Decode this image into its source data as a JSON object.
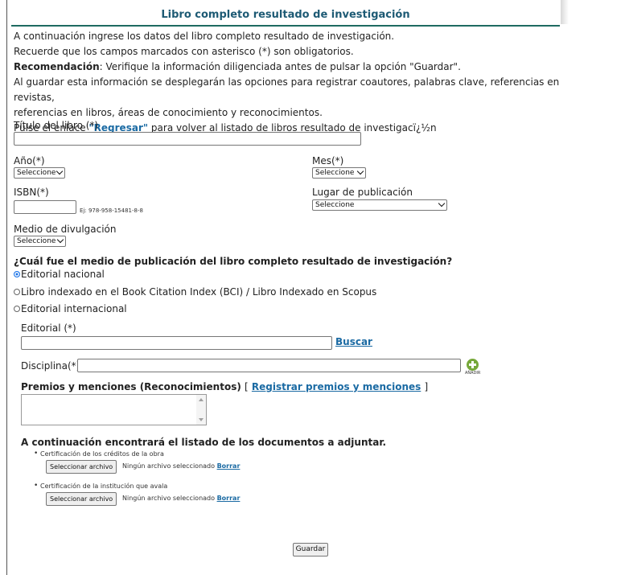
{
  "title": "Libro completo resultado de investigación",
  "intro": {
    "line1": "A continuación ingrese los datos del libro completo resultado de investigación.",
    "line2": "Recuerde que los campos marcados con asterisco (*) son obligatorios.",
    "rec_label": "Recomendación",
    "rec_text": ": Verifique la información diligenciada antes de pulsar la opción \"Guardar\".",
    "line4": "Al guardar esta información se desplegarán las opciones para registrar coautores, palabras clave, referencias en revistas,",
    "line5": "referencias en libros, áreas de conocimiento y reconocimientos.",
    "return_pre": "Pulse el enlace ",
    "return_link": "\"Regresar\"",
    "return_post": " para volver al listado de libros resultado de investigacï¿½n"
  },
  "form": {
    "titulo_label": "Título del libro (*)",
    "titulo_value": "",
    "anio_label": "Año(*)",
    "anio_value": "Seleccione",
    "mes_label": "Mes(*)",
    "mes_value": "Seleccione",
    "isbn_label": "ISBN(*)",
    "isbn_value": "",
    "isbn_hint": "Ej: 978-958-15481-8-8",
    "lugar_label": "Lugar de publicación",
    "lugar_value": "Seleccione",
    "medio_label": "Medio de divulgación",
    "medio_value": "Seleccione"
  },
  "publication": {
    "question": "¿Cuál fue el medio de publicación del libro completo resultado de investigación?",
    "options": [
      {
        "label": "Editorial nacional",
        "selected": true
      },
      {
        "label": "Libro indexado en el Book Citation Index (BCI) / Libro Indexado en Scopus",
        "selected": false
      },
      {
        "label": "Editorial internacional",
        "selected": false
      }
    ]
  },
  "editorial": {
    "label": "Editorial (*)",
    "value": "",
    "search_link": "Buscar"
  },
  "disciplina": {
    "label": "Disciplina(*)",
    "value": "",
    "add_label": "AÑADIR",
    "add_icon": "plus-circle-icon"
  },
  "premios": {
    "label": "Premios y menciones (Reconocimientos)",
    "bracket_open": "[",
    "link": "Registrar premios y menciones",
    "bracket_close": "]"
  },
  "documents": {
    "heading": "A continuación encontrará el listado de los documentos a adjuntar.",
    "items": [
      {
        "label": "Certificación de los créditos de la obra",
        "button": "Seleccionar archivo",
        "status": "Ningún archivo seleccionado",
        "clear": "Borrar"
      },
      {
        "label": "Certificación de la institución que avala",
        "button": "Seleccionar archivo",
        "status": "Ningún archivo seleccionado",
        "clear": "Borrar"
      }
    ]
  },
  "save_label": "Guardar",
  "colors": {
    "title": "#1d5a74",
    "rule": "#1e6b61",
    "link": "#1a6aa3",
    "add_icon": "#76a83a"
  }
}
